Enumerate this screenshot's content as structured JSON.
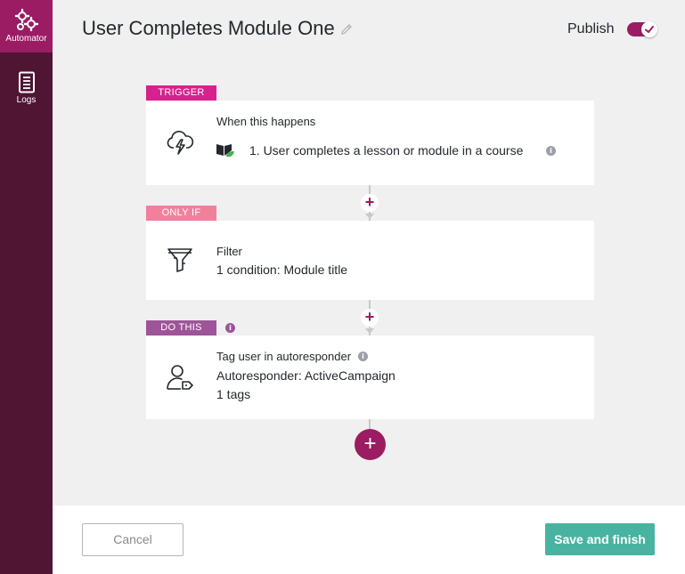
{
  "sidebar": {
    "items": [
      {
        "label": "Automator",
        "icon": "gears-icon"
      },
      {
        "label": "Logs",
        "icon": "document-icon"
      }
    ]
  },
  "header": {
    "title": "User Completes Module One",
    "publish_label": "Publish",
    "publish_enabled": true
  },
  "trigger": {
    "badge": "TRIGGER",
    "heading": "When this happens",
    "item": "1. User completes a lesson or module in a course"
  },
  "condition": {
    "badge": "ONLY IF",
    "heading": "Filter",
    "detail": "1 condition: Module title"
  },
  "action": {
    "badge": "DO THIS",
    "heading": "Tag user in autoresponder",
    "detail1": "Autoresponder: ActiveCampaign",
    "detail2": "1 tags"
  },
  "footer": {
    "cancel_label": "Cancel",
    "save_label": "Save and finish"
  },
  "colors": {
    "brand": "#9b1c63",
    "sidebar": "#4f1533",
    "trigger_badge": "#d6218e",
    "onlyif_badge": "#f1809c",
    "dothis_badge": "#9d5498",
    "save_button": "#48b3a0"
  }
}
